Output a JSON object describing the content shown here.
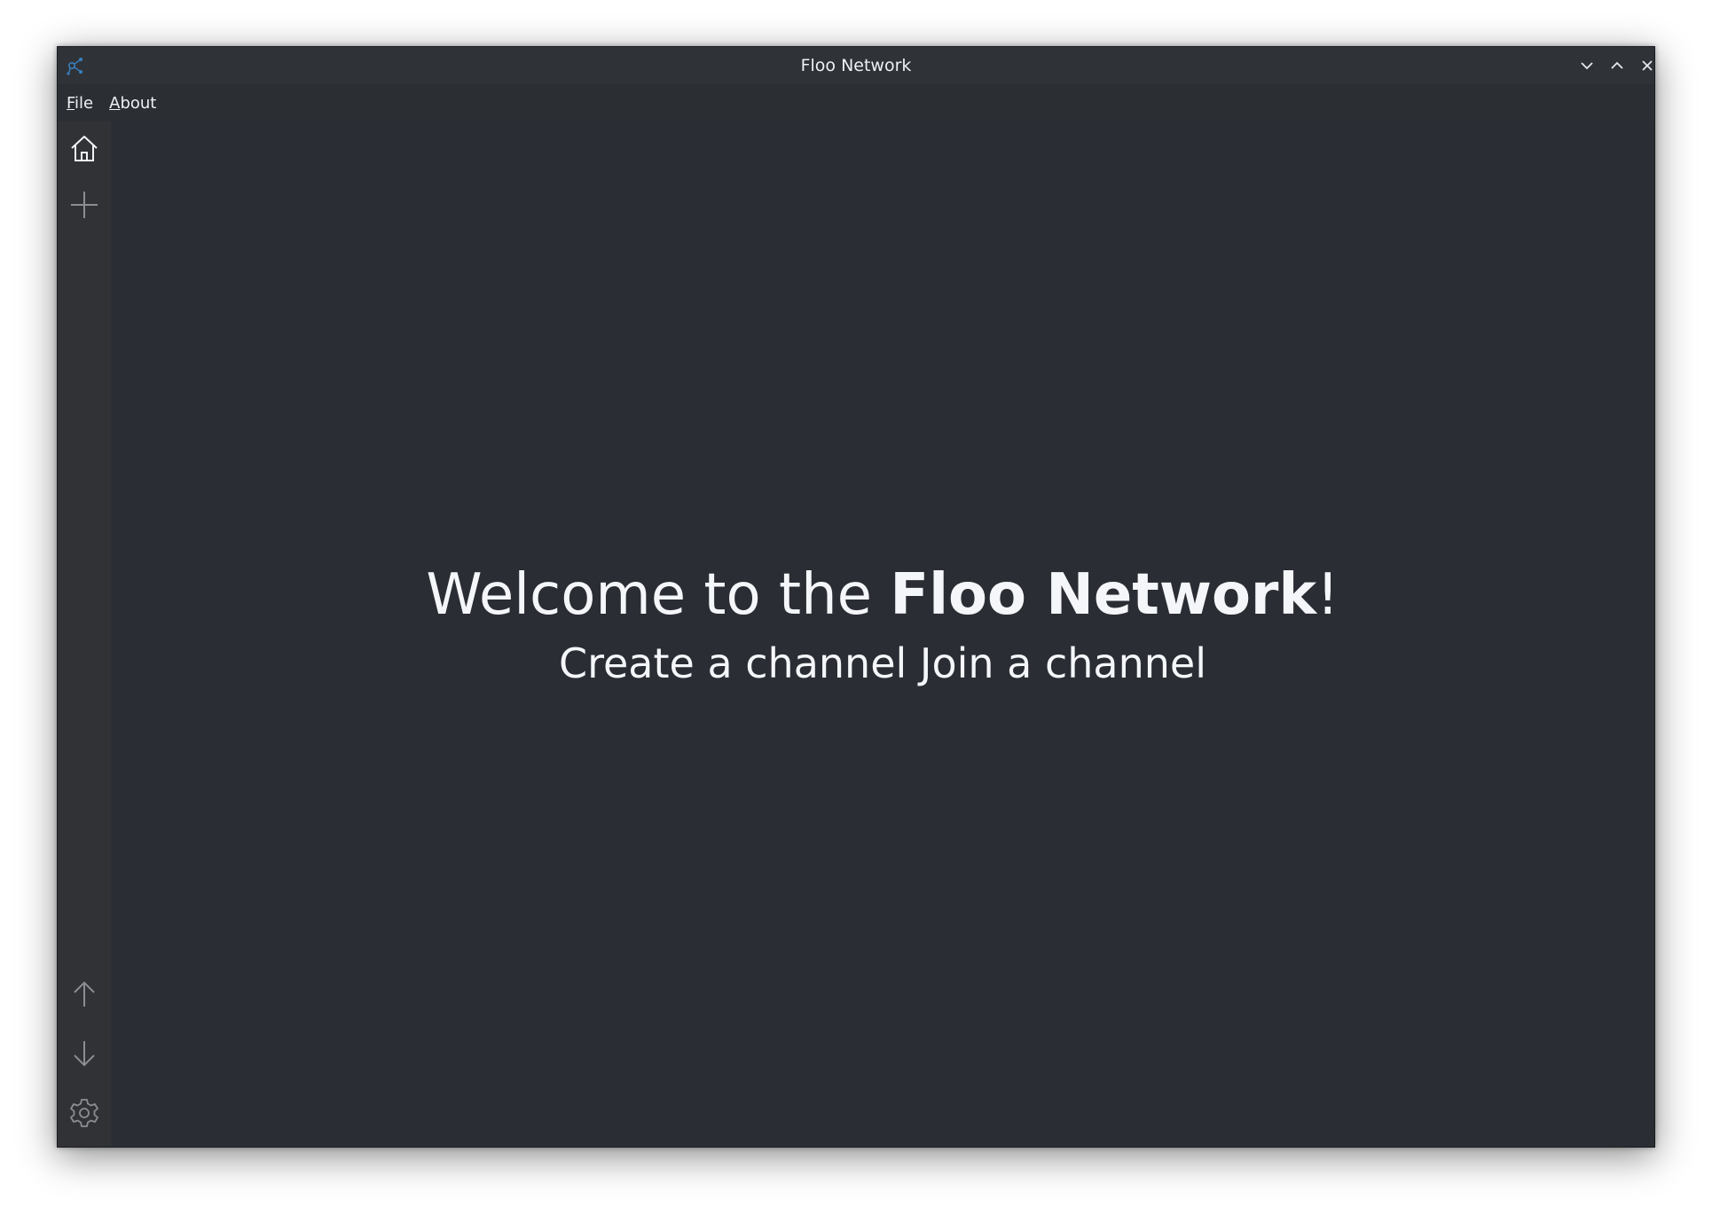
{
  "window": {
    "title": "Floo Network",
    "controls": {
      "minimize": "chevron-down-icon",
      "maximize": "chevron-up-icon",
      "close": "close-icon"
    }
  },
  "menubar": {
    "file_mnemonic": "F",
    "file_rest": "ile",
    "about_mnemonic": "A",
    "about_rest": "bout"
  },
  "sidebar": {
    "top_icons": [
      "home-icon",
      "plus-icon"
    ],
    "bottom_icons": [
      "arrow-up-icon",
      "arrow-down-icon",
      "gear-icon"
    ]
  },
  "welcome": {
    "prefix": "Welcome to the ",
    "brand": "Floo Network",
    "suffix": "!",
    "create_channel": "Create a channel",
    "join_channel": "Join a channel"
  },
  "colors": {
    "window_bg": "#2a2d33",
    "titlebar_bg": "#2f3338",
    "sidebar_bg": "#303236",
    "text": "#f4f6f9",
    "icon_muted": "#8a8d92",
    "app_icon": "#3a7fbf"
  }
}
